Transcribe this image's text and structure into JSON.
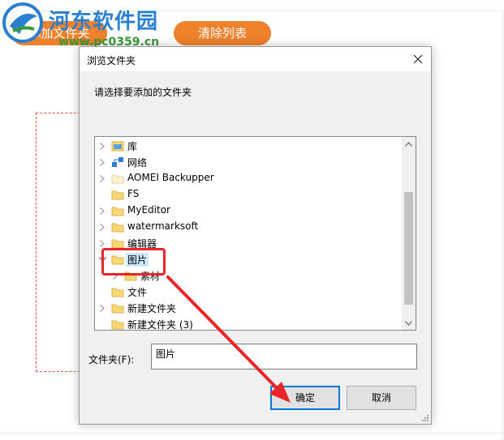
{
  "watermark": {
    "title": "河东软件园",
    "url": "www.pc0359.cn"
  },
  "app": {
    "add_button": "添加文件夹",
    "clear_button": "清除列表"
  },
  "dialog": {
    "title": "浏览文件夹",
    "prompt": "请选择要添加的文件夹",
    "tree_items": [
      {
        "label": "库",
        "icon": "library-icon",
        "chevron": "right",
        "indent": 0
      },
      {
        "label": "网络",
        "icon": "network-icon",
        "chevron": "right",
        "indent": 0
      },
      {
        "label": "AOMEI Backupper",
        "icon": "folder-light-icon",
        "chevron": "right",
        "indent": 0
      },
      {
        "label": "FS",
        "icon": "folder-icon",
        "chevron": "none",
        "indent": 0
      },
      {
        "label": "MyEditor",
        "icon": "folder-icon",
        "chevron": "right",
        "indent": 0
      },
      {
        "label": "watermarksoft",
        "icon": "folder-icon",
        "chevron": "right",
        "indent": 0
      },
      {
        "label": "编辑器",
        "icon": "folder-icon",
        "chevron": "right",
        "indent": 0
      },
      {
        "label": "图片",
        "icon": "folder-icon",
        "chevron": "down",
        "indent": 0,
        "selected": true
      },
      {
        "label": "素材",
        "icon": "folder-icon",
        "chevron": "right",
        "indent": 1
      },
      {
        "label": "文件",
        "icon": "folder-icon",
        "chevron": "none",
        "indent": 0
      },
      {
        "label": "新建文件夹",
        "icon": "folder-icon",
        "chevron": "right",
        "indent": 0
      },
      {
        "label": "新建文件夹 (3)",
        "icon": "folder-icon",
        "chevron": "none",
        "indent": 0
      }
    ],
    "folder_label": "文件夹(F):",
    "folder_value": "图片",
    "ok_button": "确定",
    "cancel_button": "取消"
  },
  "colors": {
    "accent_orange": "#f0812c",
    "annotation_red": "#e8262a",
    "selection_blue": "#cce8ff",
    "focus_blue": "#0078d7",
    "folder_yellow": "#f8d775"
  }
}
